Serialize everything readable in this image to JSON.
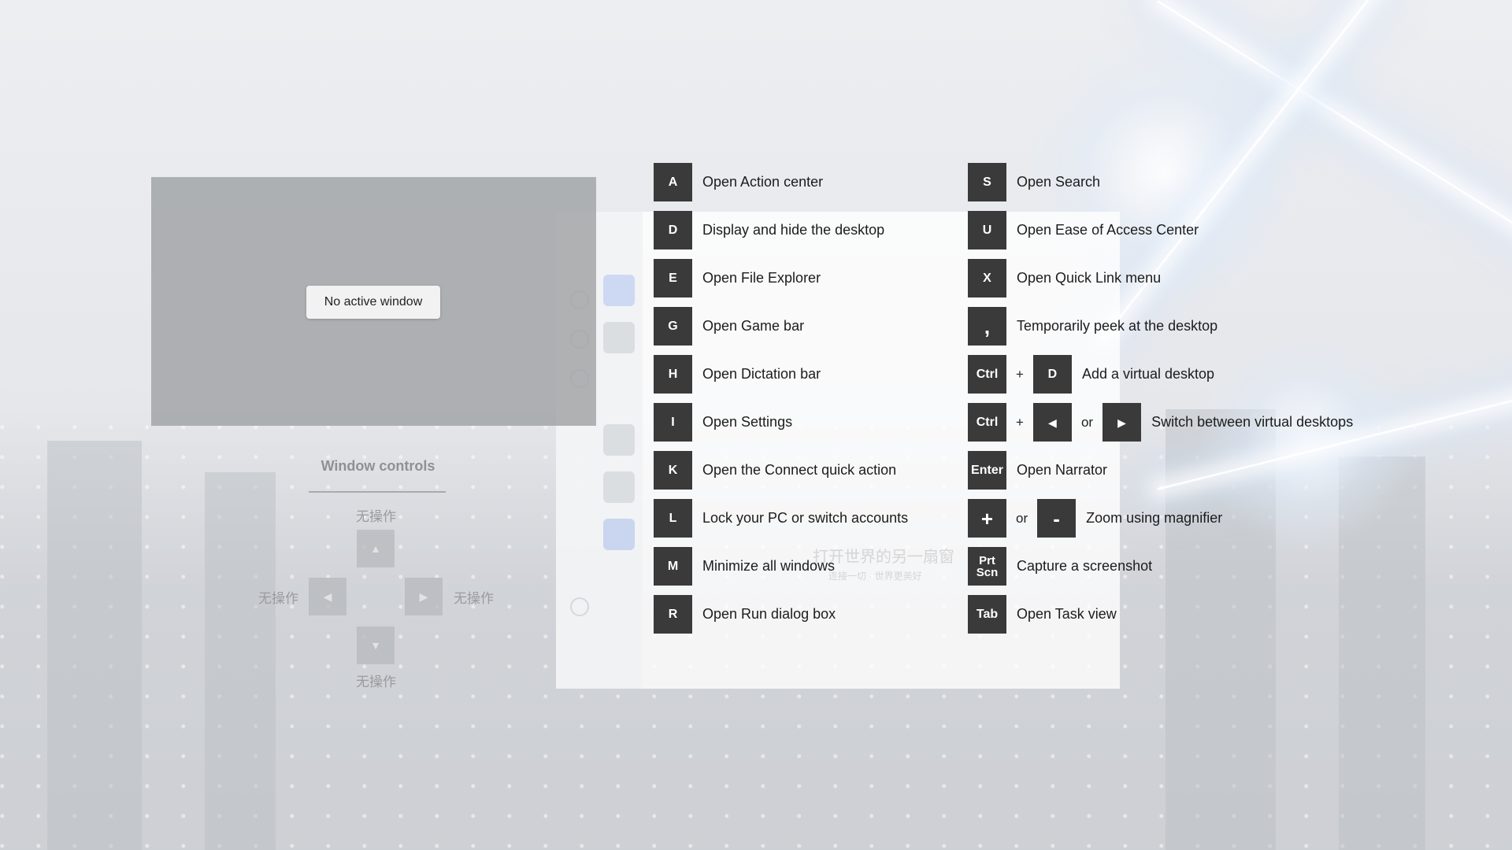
{
  "preview": {
    "status": "No active window"
  },
  "window_controls": {
    "title": "Window controls",
    "up_label": "无操作",
    "left_label": "无操作",
    "right_label": "无操作",
    "down_label": "无操作"
  },
  "background_app": {
    "headline": "打开世界的另一扇窗",
    "subline": "连接一切 · 世界更美好"
  },
  "shortcuts_left": [
    {
      "key": "A",
      "label": "Open Action center"
    },
    {
      "key": "D",
      "label": "Display and hide the desktop"
    },
    {
      "key": "E",
      "label": "Open File Explorer"
    },
    {
      "key": "G",
      "label": "Open Game bar"
    },
    {
      "key": "H",
      "label": "Open Dictation bar"
    },
    {
      "key": "I",
      "label": "Open Settings"
    },
    {
      "key": "K",
      "label": "Open the Connect quick action"
    },
    {
      "key": "L",
      "label": "Lock your PC or switch accounts"
    },
    {
      "key": "M",
      "label": "Minimize all windows"
    },
    {
      "key": "R",
      "label": "Open Run dialog box"
    }
  ],
  "shortcuts_right": [
    {
      "key": "S",
      "label": "Open Search"
    },
    {
      "key": "U",
      "label": "Open Ease of Access Center"
    },
    {
      "key": "X",
      "label": "Open Quick Link menu"
    },
    {
      "key": ",",
      "label": "Temporarily peek at the desktop"
    },
    {
      "key": "Ctrl",
      "plus": "+",
      "key2": "D",
      "label": "Add a virtual desktop"
    },
    {
      "key": "Ctrl",
      "plus": "+",
      "key2": "◀",
      "or": "or",
      "key3": "▶",
      "label": "Switch between virtual desktops"
    },
    {
      "key": "Enter",
      "label": "Open Narrator"
    },
    {
      "key": "+",
      "or": "or",
      "key2": "-",
      "label": "Zoom using magnifier"
    },
    {
      "key": "Prt Scn",
      "label": "Capture a screenshot"
    },
    {
      "key": "Tab",
      "label": "Open Task view"
    }
  ],
  "icons": {
    "up": "triangle-up-icon",
    "down": "triangle-down-icon",
    "left": "triangle-left-icon",
    "right": "triangle-right-icon"
  }
}
